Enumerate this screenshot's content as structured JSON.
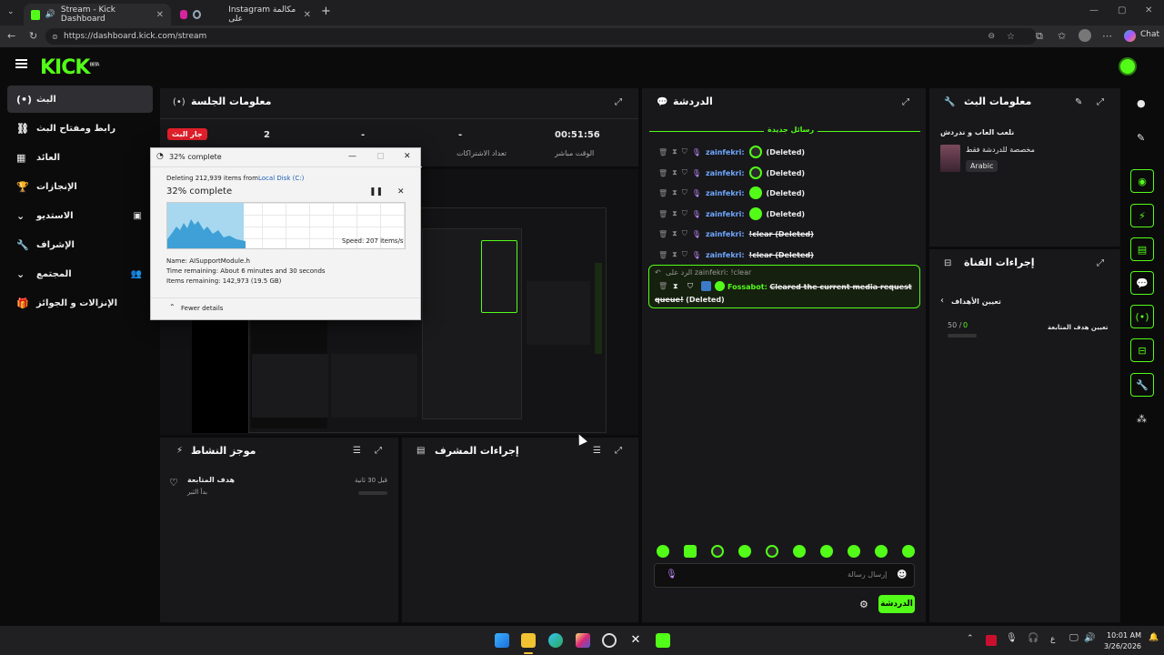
{
  "browser": {
    "tabs": [
      {
        "label": "Stream - Kick Dashboard",
        "active": true
      },
      {
        "label": "Instagram مكالمة على",
        "active": false
      }
    ],
    "url": "https://dashboard.kick.com/stream",
    "chat_label": "Chat"
  },
  "logo": {
    "text": "KICK",
    "badge": "BETA"
  },
  "sidebar": {
    "items": [
      {
        "label": "البث",
        "icon": "broadcast-icon",
        "active": true
      },
      {
        "label": "رابط ومفتاح البث",
        "icon": "link-icon"
      },
      {
        "label": "العائد",
        "icon": "revenue-icon"
      },
      {
        "label": "الإنجازات",
        "icon": "trophy-icon"
      },
      {
        "label": "الاستديو",
        "icon": "chevron-down-icon"
      },
      {
        "label": "الإشراف",
        "icon": "wrench-icon"
      },
      {
        "label": "المجتمع",
        "icon": "chevron-down-icon"
      },
      {
        "label": "الإنزالات و الجوائز",
        "icon": "gift-icon"
      }
    ]
  },
  "session": {
    "title": "معلومات الجلسة",
    "live_badge": "جار البث",
    "values": [
      "2",
      "-",
      "-",
      "00:51:56"
    ],
    "labels": [
      "",
      "",
      "تعداد الاشتراكات",
      "الوقت مباشر"
    ]
  },
  "activity": {
    "title": "موجز النشاط",
    "item_title": "هدف المتابعة",
    "item_sub": "بدأ الثبر",
    "item_time": "قبل 30 ثانية"
  },
  "modactions": {
    "title": "إجراءات المشرف"
  },
  "chat": {
    "title": "الدردشة",
    "new_messages": "رسائل جديدة",
    "messages": [
      {
        "user": "zainfekri:",
        "text": "(Deleted)",
        "emote": "dark"
      },
      {
        "user": "zainfekri:",
        "text": "(Deleted)",
        "emote": "dark"
      },
      {
        "user": "zainfekri:",
        "text": "(Deleted)",
        "emote": "green"
      },
      {
        "user": "zainfekri:",
        "text": "(Deleted)",
        "emote": "green"
      },
      {
        "user": "zainfekri:",
        "text": "!clear (Deleted)",
        "emote": "none"
      },
      {
        "user": "zainfekri:",
        "text": "!clear (Deleted)",
        "emote": "none"
      }
    ],
    "reply_to": "الرد على zainfekri: !clear",
    "bot_user": "Fossabot:",
    "bot_text": "Cleared the current media request queue!",
    "bot_deleted": "(Deleted)",
    "input_placeholder": "إرسال رسالة",
    "send_label": "الدردشة"
  },
  "stream_info": {
    "title": "معلومات البث",
    "category": "نلعب العاب و ندردش",
    "sub": "مخصصة للدردشة فقط",
    "language": "Arabic"
  },
  "channel_actions": {
    "title": "إجراءات القناة",
    "goals_link": "تعيين الأهداف",
    "goal_label": "تعيين هدف المتابعة",
    "goal_current": "0",
    "goal_total": "50 /"
  },
  "dialog": {
    "title": "32% complete",
    "deleting": "Deleting 212,939 items from",
    "location": "Local Disk (C:)",
    "percent": "32% complete",
    "speed": "Speed: 207 items/s",
    "name": "Name: AISupportModule.h",
    "time_remaining": "Time remaining: About 6 minutes and 30 seconds",
    "items_remaining": "Items remaining: 142,973 (19.5 GB)",
    "fewer_details": "Fewer details",
    "progress": 0.32
  },
  "taskbar": {
    "lang": "ع",
    "time": "10:01 AM",
    "date": "3/26/2026"
  }
}
